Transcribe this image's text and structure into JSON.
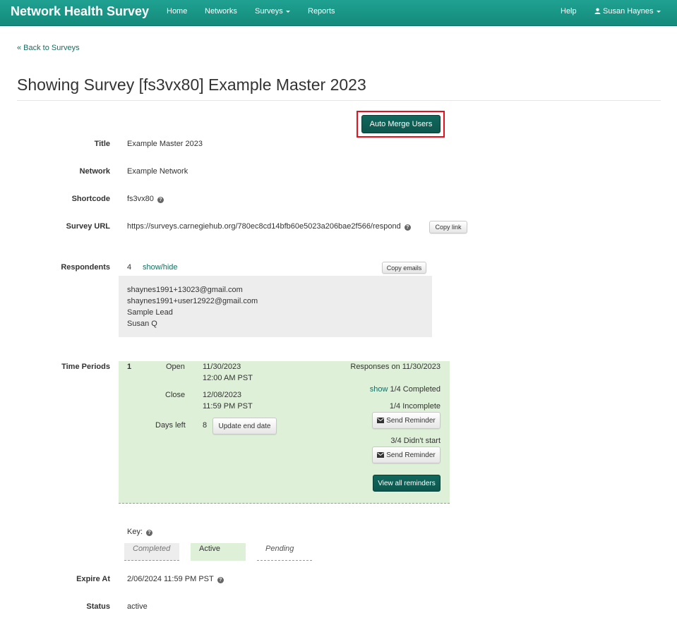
{
  "navbar": {
    "brand": "Network Health Survey",
    "items": [
      {
        "label": "Home"
      },
      {
        "label": "Networks"
      },
      {
        "label": "Surveys"
      },
      {
        "label": "Reports"
      }
    ],
    "help": "Help",
    "user": "Susan Haynes",
    "user_icon": "user-icon",
    "color": "#1a9a8a"
  },
  "back_link": "« Back to Surveys",
  "page_title": "Showing Survey [fs3vx80] Example Master 2023",
  "auto_merge_label": "Auto Merge Users",
  "fields": {
    "title_label": "Title",
    "title_value": "Example Master 2023",
    "network_label": "Network",
    "network_value": "Example Network",
    "shortcode_label": "Shortcode",
    "shortcode_value": "fs3vx80",
    "url_label": "Survey URL",
    "url_value": "https://surveys.carnegiehub.org/780ec8cd14bfb60e5023a206bae2f566/respond",
    "copy_link_label": "Copy link"
  },
  "respondents": {
    "label": "Respondents",
    "count": "4",
    "toggle": "show/hide",
    "copy_emails_label": "Copy emails",
    "list": [
      "shaynes1991+13023@gmail.com",
      "shaynes1991+user12922@gmail.com",
      "Sample Lead",
      "Susan Q"
    ]
  },
  "time_periods": {
    "label": "Time Periods",
    "number": "1",
    "open_label": "Open",
    "open_date": "11/30/2023",
    "open_time": "12:00 AM PST",
    "close_label": "Close",
    "close_date": "12/08/2023",
    "close_time": "11:59 PM PST",
    "days_left_label": "Days left",
    "days_left": "8",
    "update_end_label": "Update end date",
    "responses_heading": "Responses on 11/30/2023",
    "show_link": "show",
    "completed": "1/4 Completed",
    "incomplete": "1/4 Incomplete",
    "send_reminder_1": "Send Reminder",
    "didnt_start": "3/4 Didn't start",
    "send_reminder_2": "Send Reminder",
    "view_all_label": "View all reminders",
    "active_color": "#dff0d8"
  },
  "key": {
    "label": "Key:",
    "completed": "Completed",
    "active": "Active",
    "pending": "Pending"
  },
  "expire": {
    "label": "Expire At",
    "value": "2/06/2024 11:59 PM PST"
  },
  "status": {
    "label": "Status",
    "value": "active"
  },
  "accent_color": "#0c574d",
  "highlight_color": "#e8101d"
}
